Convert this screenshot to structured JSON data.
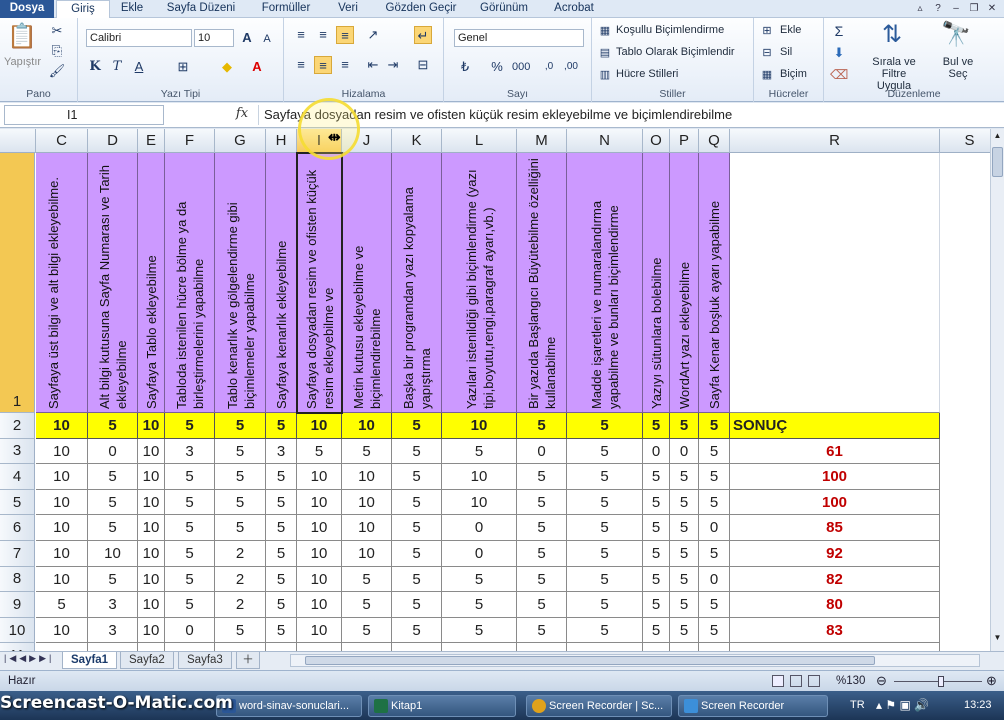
{
  "menu": {
    "tabs": [
      "Dosya",
      "Giriş",
      "Ekle",
      "Sayfa Düzeni",
      "Formüller",
      "Veri",
      "Gözden Geçir",
      "Görünüm",
      "Acrobat"
    ],
    "active": "Giriş"
  },
  "ribbon": {
    "clipboard": {
      "label": "Pano",
      "paste": "Yapıştır"
    },
    "font": {
      "label": "Yazı Tipi",
      "name": "Calibri",
      "size": "10",
      "bold": "K",
      "italic": "T",
      "underline": "A"
    },
    "alignment": {
      "label": "Hizalama"
    },
    "number": {
      "label": "Sayı",
      "format": "Genel",
      "percent": "%"
    },
    "styles": {
      "label": "Stiller",
      "conditional": "Koşullu Biçimlendirme",
      "as_table": "Tablo Olarak Biçimlendir",
      "cell_styles": "Hücre Stilleri"
    },
    "cells": {
      "label": "Hücreler",
      "insert": "Ekle",
      "delete": "Sil",
      "format": "Biçim"
    },
    "editing": {
      "label": "Düzenleme",
      "sort": "Sırala ve Filtre Uygula",
      "find": "Bul ve Seç",
      "sum": "Σ"
    }
  },
  "formula_bar": {
    "name_box": "I1",
    "fx": "fx",
    "content": "Sayfaya dosyadan resim ve ofisten küçük resim ekleyebilme ve biçimlendirebilme"
  },
  "grid": {
    "columns": [
      "C",
      "D",
      "E",
      "F",
      "G",
      "H",
      "I",
      "J",
      "K",
      "L",
      "M",
      "N",
      "O",
      "P",
      "Q",
      "R",
      "S"
    ],
    "selected_column": "I",
    "row_numbers": [
      "1",
      "2",
      "3",
      "4",
      "5",
      "6",
      "7",
      "8",
      "9",
      "10",
      "11"
    ],
    "headers": [
      "Sayfaya üst bilgi ve alt bilgi ekleyebilme.",
      "Alt bilgi kutusuna Sayfa Numarası ve Tarih ekleyebilme",
      "Sayfaya Tablo ekleyebilme",
      "Tabloda istenilen hücre bölme ya da birleştirmelerini yapabilme",
      "Tablo kenarlık ve gölgelendirme gibi biçimlemeler yapabilme",
      "Sayfaya kenarlık ekleyebilme",
      "Sayfaya dosyadan resim ve ofisten küçük resim ekleyebilme ve",
      "Metin kutusu ekleyebilme ve biçimlendirebilme",
      "Başka bir programdan yazı kopyalama yapıştırma",
      "Yazıları istenildiği gibi biçimlendirme (yazı tipi,boyutu,rengi,paragraf ayarı,vb.)",
      "Bir yazıda Başlangıcı Büyütebilme özelliğini kullanabilme",
      "Madde işaretleri ve numaralandırma yapabilme ve bunları biçimlendirme",
      "Yazıyı sütunlara bolebilme",
      "WordArt yazı ekleyebilme",
      "Sayfa Kenar boşluk ayarı yapabilme"
    ],
    "points_row": [
      "10",
      "5",
      "10",
      "5",
      "5",
      "5",
      "10",
      "10",
      "5",
      "10",
      "5",
      "5",
      "5",
      "5",
      "5"
    ],
    "result_label": "SONUÇ",
    "rows": [
      {
        "values": [
          "10",
          "0",
          "10",
          "3",
          "5",
          "3",
          "5",
          "5",
          "5",
          "5",
          "0",
          "5",
          "0",
          "0",
          "5"
        ],
        "result": "61"
      },
      {
        "values": [
          "10",
          "5",
          "10",
          "5",
          "5",
          "5",
          "10",
          "10",
          "5",
          "10",
          "5",
          "5",
          "5",
          "5",
          "5"
        ],
        "result": "100"
      },
      {
        "values": [
          "10",
          "5",
          "10",
          "5",
          "5",
          "5",
          "10",
          "10",
          "5",
          "10",
          "5",
          "5",
          "5",
          "5",
          "5"
        ],
        "result": "100"
      },
      {
        "values": [
          "10",
          "5",
          "10",
          "5",
          "5",
          "5",
          "10",
          "10",
          "5",
          "0",
          "5",
          "5",
          "5",
          "5",
          "0"
        ],
        "result": "85"
      },
      {
        "values": [
          "10",
          "10",
          "10",
          "5",
          "2",
          "5",
          "10",
          "10",
          "5",
          "0",
          "5",
          "5",
          "5",
          "5",
          "5"
        ],
        "result": "92"
      },
      {
        "values": [
          "10",
          "5",
          "10",
          "5",
          "2",
          "5",
          "10",
          "5",
          "5",
          "5",
          "5",
          "5",
          "5",
          "5",
          "0"
        ],
        "result": "82"
      },
      {
        "values": [
          "5",
          "3",
          "10",
          "5",
          "2",
          "5",
          "10",
          "5",
          "5",
          "5",
          "5",
          "5",
          "5",
          "5",
          "5"
        ],
        "result": "80"
      },
      {
        "values": [
          "10",
          "3",
          "10",
          "0",
          "5",
          "5",
          "10",
          "5",
          "5",
          "5",
          "5",
          "5",
          "5",
          "5",
          "5"
        ],
        "result": "83"
      }
    ]
  },
  "sheets": {
    "tabs": [
      "Sayfa1",
      "Sayfa2",
      "Sayfa3"
    ],
    "active": "Sayfa1"
  },
  "status": {
    "ready": "Hazır",
    "zoom": "%130"
  },
  "taskbar": {
    "watermark": "Screencast-O-Matic.com",
    "items": [
      "word-sinav-sonuclari...",
      "Kitap1",
      "Screen Recorder | Sc...",
      "Screen Recorder"
    ],
    "lang": "TR",
    "time": "13:23"
  },
  "colors": {
    "header_purple": "#cc99ff",
    "points_yellow": "#ffff00",
    "result_red": "#c00000"
  }
}
